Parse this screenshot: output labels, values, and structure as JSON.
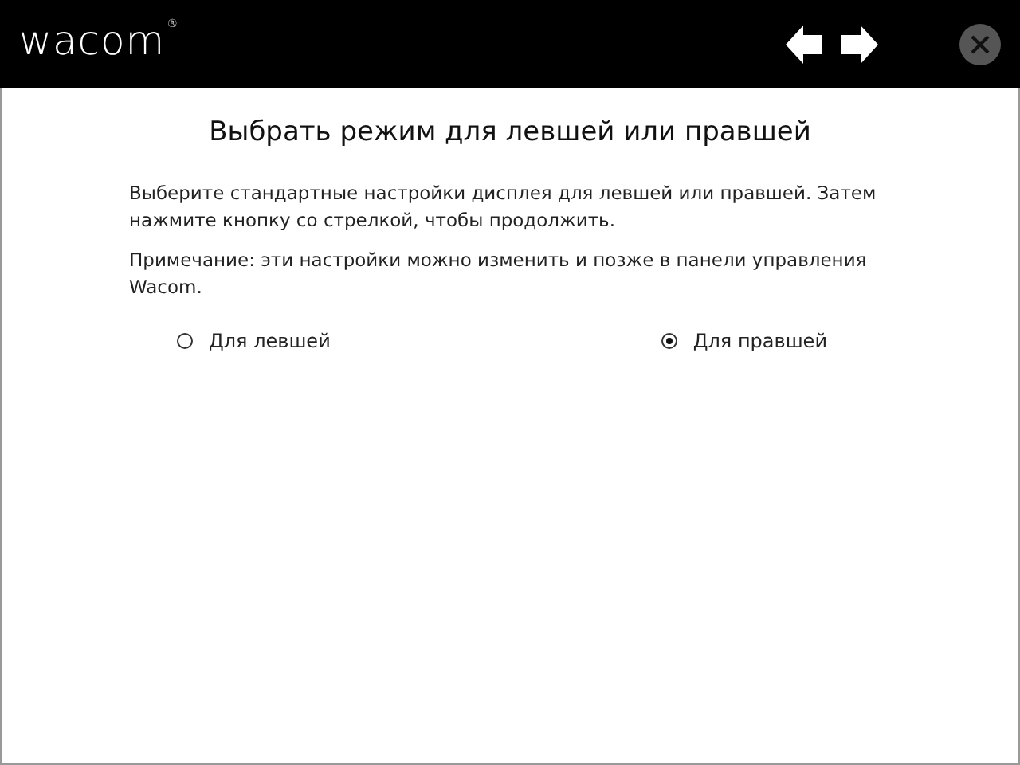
{
  "header": {
    "logo": "wacom",
    "logo_mark": "®"
  },
  "title": "Выбрать режим для левшей или правшей",
  "paragraphs": [
    "Выберите стандартные настройки дисплея для левшей или правшей. Затем нажмите кнопку со стрелкой, чтобы продолжить.",
    "Примечание: эти настройки можно изменить и позже в панели управления Wacom."
  ],
  "options": [
    {
      "label": "Для левшей",
      "selected": false
    },
    {
      "label": "Для правшей",
      "selected": true
    }
  ]
}
